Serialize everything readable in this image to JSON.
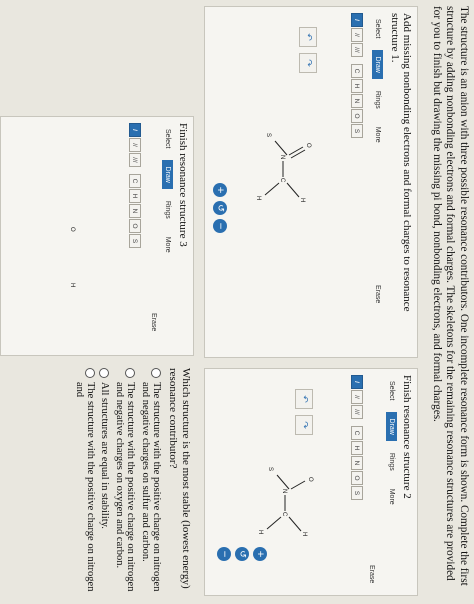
{
  "intro": "The structure is an anion with three possible resonance contributors. One incomplete resonance form is shown. Complete the first structure by adding nonbonding electrons and formal charges. The skeletons for the remaining resonance structures are provided for you to finish but drawing the missing pi bond, nonbonding electrons, and formal charges.",
  "panels": {
    "p1": {
      "title": "Add missing nonbonding electrons and formal charges to resonance structure 1."
    },
    "p2": {
      "title": "Finish resonance structure 2"
    },
    "p3": {
      "title": "Finish resonance structure 3"
    }
  },
  "toolbar": {
    "tabs": [
      "Select",
      "Draw",
      "Rings",
      "More"
    ],
    "erase": "Erase",
    "bonds": [
      "/",
      "//",
      "///"
    ],
    "atoms": [
      "C",
      "H",
      "N",
      "O",
      "S"
    ]
  },
  "controls": {
    "undo": "↶",
    "redo": "↷",
    "zoom_in": "+",
    "reset": "↺",
    "zoom_out": "−"
  },
  "atoms": {
    "O": "O",
    "N": "N",
    "C": "C",
    "S": "S",
    "H": "H"
  },
  "question": {
    "text": "Which structure is the most stable (lowest energy) resonance contributor?",
    "options": [
      "The structure with the positive charge on nitrogen and negative charges on sulfur and carbon.",
      "The structure with the positive charge on nitrogen and negative charges on oxygen and carbon.",
      "All structures are equal in stability.",
      "The structure with the positive charge on nitrogen and"
    ]
  },
  "colors": {
    "accent": "#2a6fb0"
  }
}
